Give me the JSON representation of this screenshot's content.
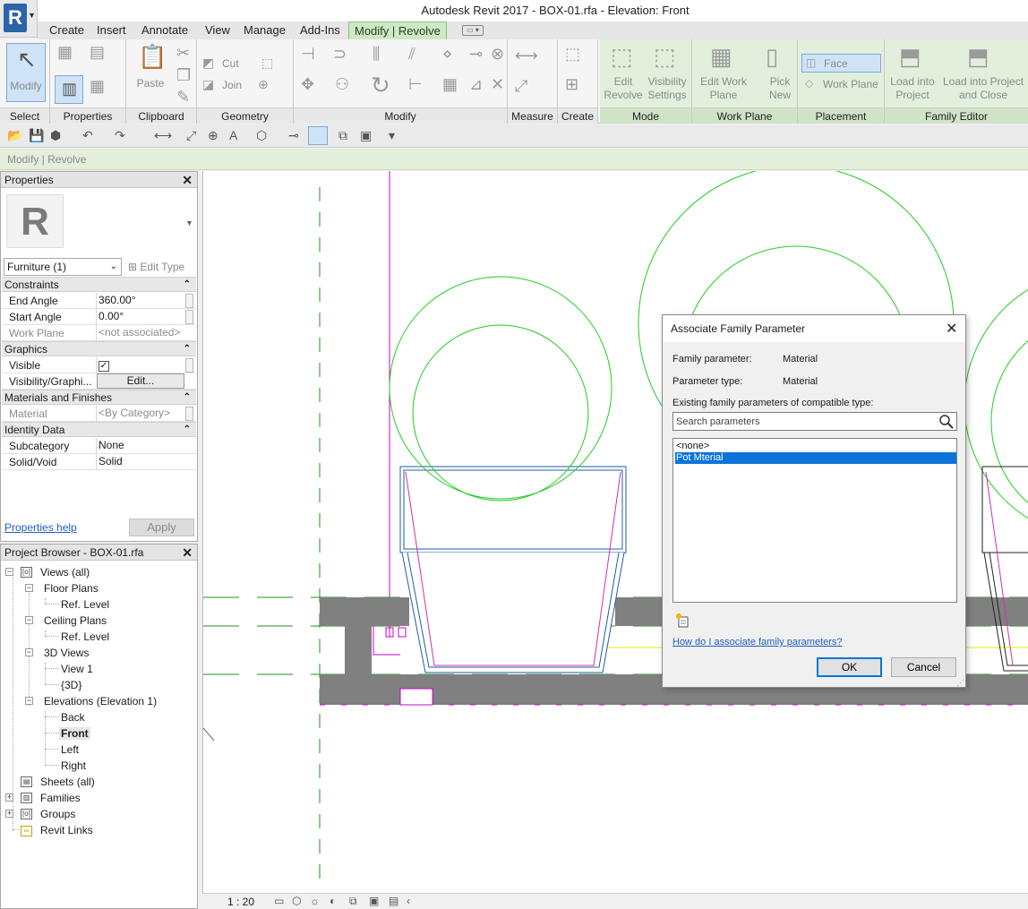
{
  "window": {
    "title": "Autodesk Revit 2017 -     BOX-01.rfa - Elevation: Front"
  },
  "ribbon": {
    "tabs": [
      {
        "label": "Create",
        "active": false
      },
      {
        "label": "Insert",
        "active": false
      },
      {
        "label": "Annotate",
        "active": false
      },
      {
        "label": "View",
        "active": false
      },
      {
        "label": "Manage",
        "active": false
      },
      {
        "label": "Add-Ins",
        "active": false
      },
      {
        "label": "Modify | Revolve",
        "active": true
      }
    ],
    "panels": {
      "select": {
        "label": "Select",
        "button": "Modify"
      },
      "properties": {
        "label": "Properties"
      },
      "clipboard": {
        "label": "Clipboard",
        "paste": "Paste"
      },
      "geometry": {
        "label": "Geometry",
        "cut": "Cut",
        "join": "Join"
      },
      "modify": {
        "label": "Modify"
      },
      "measure": {
        "label": "Measure"
      },
      "create": {
        "label": "Create"
      },
      "mode": {
        "label": "Mode",
        "edit_revolve": "Edit Revolve",
        "visibility_settings": "Visibility Settings"
      },
      "work_plane": {
        "label": "Work Plane",
        "edit_work_plane": "Edit Work Plane",
        "pick_new": "Pick New"
      },
      "placement": {
        "label": "Placement",
        "face": "Face",
        "work_plane": "Work Plane"
      },
      "family_editor": {
        "label": "Family Editor",
        "load_into_project": "Load into Project",
        "load_and_close": "Load into Project and Close"
      }
    }
  },
  "options_bar": {
    "text": "Modify | Revolve"
  },
  "properties": {
    "title": "Properties",
    "type_selector": "Furniture (1)",
    "edit_type": "Edit Type",
    "groups": {
      "constraints": "Constraints",
      "graphics": "Graphics",
      "materials": "Materials and Finishes",
      "identity": "Identity Data"
    },
    "rows": {
      "end_angle": {
        "label": "End Angle",
        "value": "360.00°"
      },
      "start_angle": {
        "label": "Start Angle",
        "value": "0.00°"
      },
      "work_plane": {
        "label": "Work Plane",
        "value": "<not associated>"
      },
      "visible": {
        "label": "Visible",
        "checked": true
      },
      "visibility_graphics": {
        "label": "Visibility/Graphi...",
        "button": "Edit..."
      },
      "material": {
        "label": "Material",
        "value": "<By Category>"
      },
      "subcategory": {
        "label": "Subcategory",
        "value": "None"
      },
      "solid_void": {
        "label": "Solid/Void",
        "value": "Solid"
      }
    },
    "help_link": "Properties help",
    "apply": "Apply"
  },
  "project_browser": {
    "title": "Project Browser - BOX-01.rfa",
    "nodes": {
      "views_all": "Views (all)",
      "floor_plans": "Floor Plans",
      "fp_ref_level": "Ref. Level",
      "ceiling_plans": "Ceiling Plans",
      "cp_ref_level": "Ref. Level",
      "views_3d": "3D Views",
      "view_1": "View 1",
      "view_3d": "{3D}",
      "elevations": "Elevations (Elevation 1)",
      "back": "Back",
      "front": "Front",
      "left": "Left",
      "right": "Right",
      "sheets": "Sheets (all)",
      "families": "Families",
      "groups": "Groups",
      "revit_links": "Revit Links"
    }
  },
  "view_control": {
    "scale": "1 : 20"
  },
  "dialog": {
    "title": "Associate Family Parameter",
    "family_parameter_label": "Family parameter:",
    "family_parameter_value": "Material",
    "parameter_type_label": "Parameter type:",
    "parameter_type_value": "Material",
    "existing_label": "Existing family parameters of compatible type:",
    "search_placeholder": "Search parameters",
    "list": [
      {
        "label": "<none>",
        "selected": false
      },
      {
        "label": "Pot Mterial",
        "selected": true
      }
    ],
    "help_link": "How do I associate family parameters?",
    "ok": "OK",
    "cancel": "Cancel"
  },
  "colors": {
    "accent_green": "#cfe7c7",
    "selection_blue": "#0a74d9",
    "sketch_green": "#22cc22",
    "ref_magenta": "#cc00cc",
    "model_blue": "#1f5f9f"
  }
}
